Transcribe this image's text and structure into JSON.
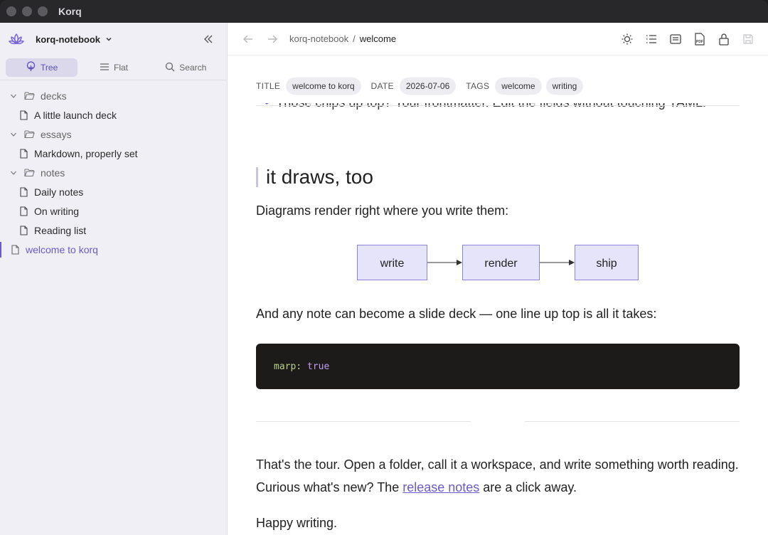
{
  "window": {
    "title": "Korq"
  },
  "sidebar": {
    "notebook": "korq-notebook",
    "views": [
      {
        "label": "Tree",
        "icon": "tree-icon",
        "active": true
      },
      {
        "label": "Flat",
        "icon": "list-icon",
        "active": false
      },
      {
        "label": "Search",
        "icon": "search-icon",
        "active": false
      }
    ],
    "tree": [
      {
        "label": "decks",
        "type": "folder"
      },
      {
        "label": "A little launch deck",
        "type": "file"
      },
      {
        "label": "essays",
        "type": "folder"
      },
      {
        "label": "Markdown, properly set",
        "type": "file"
      },
      {
        "label": "notes",
        "type": "folder"
      },
      {
        "label": "Daily notes",
        "type": "file"
      },
      {
        "label": "On writing",
        "type": "file"
      },
      {
        "label": "Reading list",
        "type": "file"
      },
      {
        "label": "welcome to korq",
        "type": "file",
        "active": true
      }
    ]
  },
  "breadcrumb": {
    "parent": "korq-notebook",
    "separator": "/",
    "current": "welcome"
  },
  "toolbar": {
    "icons": [
      "theme-icon",
      "outline-icon",
      "reader-icon",
      "pdf-export-icon",
      "lock-icon",
      "save-icon"
    ]
  },
  "frontmatter": {
    "title_key": "TITLE",
    "title": "welcome to korq",
    "date_key": "DATE",
    "date": "2026-07-06",
    "tags_key": "TAGS",
    "tags": [
      "welcome",
      "writing"
    ]
  },
  "doc": {
    "ghost_line": "Those chips up top? Your frontmatter. Edit the fields without touching YAML.",
    "heading": "it draws, too",
    "p1": "Diagrams render right where you write them:",
    "diagram": {
      "nodes": [
        "write",
        "render",
        "ship"
      ]
    },
    "p2": "And any note can become a slide deck — one line up top is all it takes:",
    "code": {
      "key": "marp:",
      "value": "true"
    },
    "p3_a": "That's the tour. Open a folder, call it a workspace, and write something worth reading. Curious what's new? The ",
    "p3_link": "release notes",
    "p3_b": " are a click away.",
    "p4": "Happy writing."
  },
  "colors": {
    "accent": "#6a5acd",
    "sidebar_bg": "#f1eff6",
    "code_bg": "#1c1b19",
    "node_fill": "#e6e4fb",
    "node_stroke": "#8e83d6"
  }
}
